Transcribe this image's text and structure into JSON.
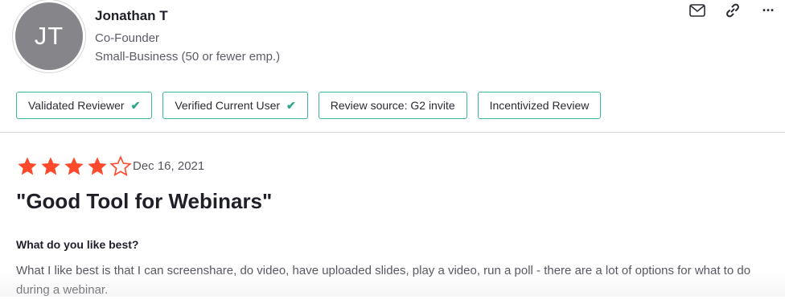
{
  "reviewer": {
    "initials": "JT",
    "name": "Jonathan T",
    "role": "Co-Founder",
    "company_size": "Small-Business (50 or fewer emp.)"
  },
  "actions": {
    "icons": [
      "mail-icon",
      "link-icon",
      "more-icon"
    ],
    "more_label": "···"
  },
  "badges": [
    {
      "label": "Validated Reviewer",
      "checked": true
    },
    {
      "label": "Verified Current User",
      "checked": true
    },
    {
      "label": "Review source: G2 invite",
      "checked": false
    },
    {
      "label": "Incentivized Review",
      "checked": false
    }
  ],
  "check_glyph": "✔",
  "review": {
    "rating": 4,
    "max_rating": 5,
    "date": "Dec 16, 2021",
    "title": "\"Good Tool for Webinars\"",
    "question": "What do you like best?",
    "answer": "What I like best is that I can screenshare, do video, have uploaded slides, play a video, run a poll - there are a lot of options for what to do during a webinar."
  },
  "colors": {
    "star": "#ff492c",
    "badge_border": "#3bb6a0",
    "check": "#2ca58d",
    "avatar_bg": "#85858a"
  }
}
